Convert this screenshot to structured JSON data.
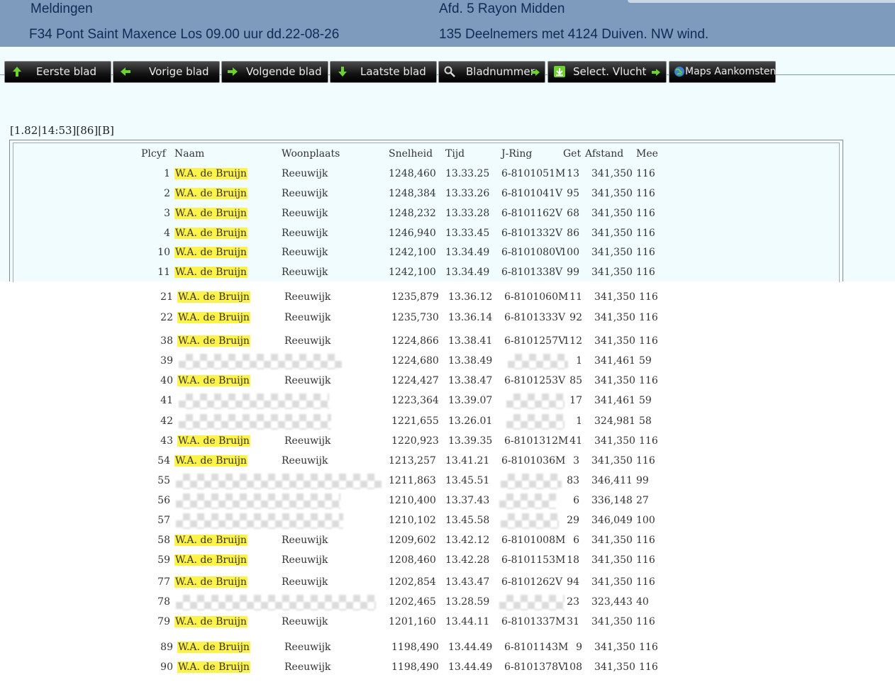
{
  "header": {
    "title": "Meldingen",
    "race": "F34 Pont Saint Maxence Los 09.00 uur  dd.22-08-26",
    "division": "Afd. 5  Rayon Midden",
    "participants": "135 Deelnemers met   4124 Duiven. NW wind."
  },
  "toolbar": {
    "first": "Eerste blad",
    "prev": "Vorige blad",
    "next": "Volgende blad",
    "last": "Laatste blad",
    "page_number": "Bladnummer",
    "select_flight": "Select. Vlucht",
    "maps": "Maps Aankomsten"
  },
  "run_info": "[1.82|14:53][86][B]",
  "table": {
    "headers": {
      "plcyf": "Plcyf",
      "naam": "Naam",
      "woonplaats": "Woonplaats",
      "snelheid": "Snelheid",
      "tijd": "Tijd",
      "jring": "J-Ring",
      "get": "Get",
      "afstand": "Afstand",
      "mee": "Mee"
    },
    "rows": [
      {
        "plaats": "1",
        "naam": "W.A. de Bruijn",
        "woonplaats": "Reeuwijk",
        "snelheid": "1248,460",
        "tijd": "13.33.25",
        "ring": "6-8101051M",
        "get": "13",
        "afstand": "341,350",
        "mee": "116"
      },
      {
        "plaats": "2",
        "naam": "W.A. de Bruijn",
        "woonplaats": "Reeuwijk",
        "snelheid": "1248,384",
        "tijd": "13.33.26",
        "ring": "6-8101041V",
        "get": "95",
        "afstand": "341,350",
        "mee": "116"
      },
      {
        "plaats": "3",
        "naam": "W.A. de Bruijn",
        "woonplaats": "Reeuwijk",
        "snelheid": "1248,232",
        "tijd": "13.33.28",
        "ring": "6-8101162V",
        "get": "68",
        "afstand": "341,350",
        "mee": "116"
      },
      {
        "plaats": "4",
        "naam": "W.A. de Bruijn",
        "woonplaats": "Reeuwijk",
        "snelheid": "1246,940",
        "tijd": "13.33.45",
        "ring": "6-8101332V",
        "get": "86",
        "afstand": "341,350",
        "mee": "116"
      },
      {
        "plaats": "10",
        "naam": "W.A. de Bruijn",
        "woonplaats": "Reeuwijk",
        "snelheid": "1242,100",
        "tijd": "13.34.49",
        "ring": "6-8101080V",
        "get": "100",
        "afstand": "341,350",
        "mee": "116"
      },
      {
        "plaats": "11",
        "naam": "W.A. de Bruijn",
        "woonplaats": "Reeuwijk",
        "snelheid": "1242,100",
        "tijd": "13.34.49",
        "ring": "6-8101338V",
        "get": "99",
        "afstand": "341,350",
        "mee": "116"
      },
      {
        "plaats": "21",
        "naam": "W.A. de Bruijn",
        "woonplaats": "Reeuwijk",
        "snelheid": "1235,879",
        "tijd": "13.36.12",
        "ring": "6-8101060M",
        "get": "11",
        "afstand": "341,350",
        "mee": "116"
      },
      {
        "plaats": "22",
        "naam": "W.A. de Bruijn",
        "woonplaats": "Reeuwijk",
        "snelheid": "1235,730",
        "tijd": "13.36.14",
        "ring": "6-8101333V",
        "get": "92",
        "afstand": "341,350",
        "mee": "116"
      },
      {
        "plaats": "38",
        "naam": "W.A. de Bruijn",
        "woonplaats": "Reeuwijk",
        "snelheid": "1224,866",
        "tijd": "13.38.41",
        "ring": "6-8101257V",
        "get": "112",
        "afstand": "341,350",
        "mee": "116"
      },
      {
        "plaats": "39",
        "naam": "",
        "woonplaats": "",
        "snelheid": "1224,680",
        "tijd": "13.38.49",
        "ring": "",
        "get": "1",
        "afstand": "341,461",
        "mee": "59"
      },
      {
        "plaats": "40",
        "naam": "W.A. de Bruijn",
        "woonplaats": "Reeuwijk",
        "snelheid": "1224,427",
        "tijd": "13.38.47",
        "ring": "6-8101253V",
        "get": "85",
        "afstand": "341,350",
        "mee": "116"
      },
      {
        "plaats": "41",
        "naam": "",
        "woonplaats": "",
        "snelheid": "1223,364",
        "tijd": "13.39.07",
        "ring": "",
        "get": "17",
        "afstand": "341,461",
        "mee": "59"
      },
      {
        "plaats": "42",
        "naam": "",
        "woonplaats": "",
        "snelheid": "1221,655",
        "tijd": "13.26.01",
        "ring": "",
        "get": "1",
        "afstand": "324,981",
        "mee": "58"
      },
      {
        "plaats": "43",
        "naam": "W.A. de Bruijn",
        "woonplaats": "Reeuwijk",
        "snelheid": "1220,923",
        "tijd": "13.39.35",
        "ring": "6-8101312M",
        "get": "41",
        "afstand": "341,350",
        "mee": "116"
      },
      {
        "plaats": "54",
        "naam": "W.A. de Bruijn",
        "woonplaats": "Reeuwijk",
        "snelheid": "1213,257",
        "tijd": "13.41.21",
        "ring": "6-8101036M",
        "get": "3",
        "afstand": "341,350",
        "mee": "116"
      },
      {
        "plaats": "55",
        "naam": "",
        "woonplaats": "",
        "snelheid": "1211,863",
        "tijd": "13.45.51",
        "ring": "",
        "get": "83",
        "afstand": "346,411",
        "mee": "99"
      },
      {
        "plaats": "56",
        "naam": "",
        "woonplaats": "",
        "snelheid": "1210,400",
        "tijd": "13.37.43",
        "ring": "",
        "get": "6",
        "afstand": "336,148",
        "mee": "27"
      },
      {
        "plaats": "57",
        "naam": "",
        "woonplaats": "",
        "snelheid": "1210,102",
        "tijd": "13.45.58",
        "ring": "",
        "get": "29",
        "afstand": "346,049",
        "mee": "100"
      },
      {
        "plaats": "58",
        "naam": "W.A. de Bruijn",
        "woonplaats": "Reeuwijk",
        "snelheid": "1209,602",
        "tijd": "13.42.12",
        "ring": "6-8101008M",
        "get": "6",
        "afstand": "341,350",
        "mee": "116"
      },
      {
        "plaats": "59",
        "naam": "W.A. de Bruijn",
        "woonplaats": "Reeuwijk",
        "snelheid": "1208,460",
        "tijd": "13.42.28",
        "ring": "6-8101153M",
        "get": "18",
        "afstand": "341,350",
        "mee": "116"
      },
      {
        "plaats": "77",
        "naam": "W.A. de Bruijn",
        "woonplaats": "Reeuwijk",
        "snelheid": "1202,854",
        "tijd": "13.43.47",
        "ring": "6-8101262V",
        "get": "94",
        "afstand": "341,350",
        "mee": "116"
      },
      {
        "plaats": "78",
        "naam": "",
        "woonplaats": "",
        "snelheid": "1202,465",
        "tijd": "13.28.59",
        "ring": "",
        "get": "23",
        "afstand": "323,443",
        "mee": "40"
      },
      {
        "plaats": "79",
        "naam": "W.A. de Bruijn",
        "woonplaats": "Reeuwijk",
        "snelheid": "1201,160",
        "tijd": "13.44.11",
        "ring": "6-8101337M",
        "get": "31",
        "afstand": "341,350",
        "mee": "116"
      },
      {
        "plaats": "89",
        "naam": "W.A. de Bruijn",
        "woonplaats": "Reeuwijk",
        "snelheid": "1198,490",
        "tijd": "13.44.49",
        "ring": "6-8101143M",
        "get": "9",
        "afstand": "341,350",
        "mee": "116"
      },
      {
        "plaats": "90",
        "naam": "W.A. de Bruijn",
        "woonplaats": "Reeuwijk",
        "snelheid": "1198,490",
        "tijd": "13.44.49",
        "ring": "6-8101378V",
        "get": "108",
        "afstand": "341,350",
        "mee": "116"
      }
    ]
  },
  "colors": {
    "header": "#7e9bbd",
    "header_text": "#0f2c55",
    "band": "#f0fcfd",
    "highlight": "#fff34a",
    "toolbar": "#121212"
  }
}
